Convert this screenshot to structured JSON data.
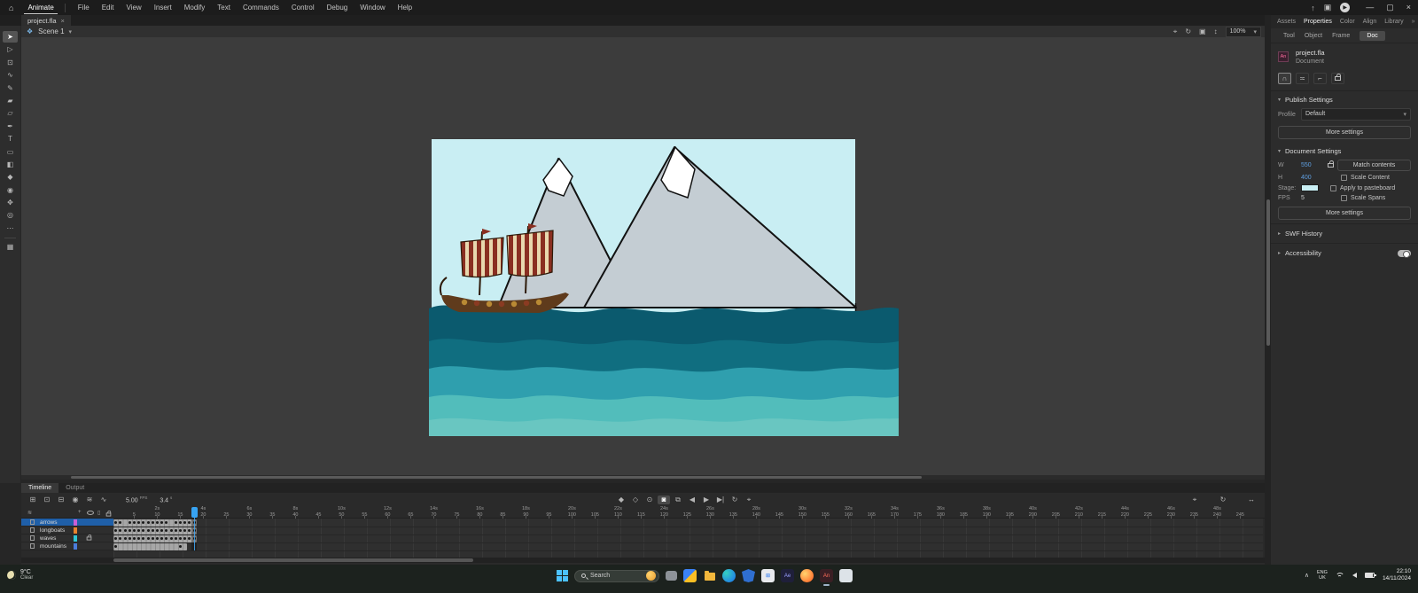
{
  "titlebar": {
    "home_icon": "⌂",
    "app_menu": "Animate",
    "menus": [
      "File",
      "Edit",
      "View",
      "Insert",
      "Modify",
      "Text",
      "Commands",
      "Control",
      "Debug",
      "Window",
      "Help"
    ],
    "share_icon": "↑",
    "workspace_icon": "▣",
    "play_icon": "▶",
    "minimize": "—",
    "maximize": "▢",
    "close": "×"
  },
  "document_tab": {
    "title": "project.fla",
    "close": "×"
  },
  "edit_bar": {
    "scene_icon": "❖",
    "scene": "Scene 1",
    "chevron": "▾",
    "zoom": "100%",
    "icons": [
      {
        "name": "center-stage-icon",
        "glyph": "⌖"
      },
      {
        "name": "rotation-icon",
        "glyph": "↻"
      },
      {
        "name": "clip-content-icon",
        "glyph": "▣"
      },
      {
        "name": "zoom-stepper-icon",
        "glyph": "↕"
      }
    ]
  },
  "tools": {
    "items": [
      {
        "name": "selection-tool",
        "glyph": "➤",
        "selected": true
      },
      {
        "name": "subselection-tool",
        "glyph": "▷",
        "selected": false
      },
      {
        "name": "free-transform-tool",
        "glyph": "⊡",
        "selected": false
      },
      {
        "name": "lasso-tool",
        "glyph": "∿",
        "selected": false
      },
      {
        "name": "fluid-brush-tool",
        "glyph": "✎",
        "selected": false
      },
      {
        "name": "classic-brush-tool",
        "glyph": "▰",
        "selected": false
      },
      {
        "name": "eraser-tool",
        "glyph": "▱",
        "selected": false
      },
      {
        "name": "pen-tool",
        "glyph": "✒",
        "selected": false
      },
      {
        "name": "text-tool",
        "glyph": "T",
        "selected": false
      },
      {
        "name": "rectangle-tool",
        "glyph": "▭",
        "selected": false
      },
      {
        "name": "paint-bucket-tool",
        "glyph": "◧",
        "selected": false
      },
      {
        "name": "eyedropper-tool",
        "glyph": "◆",
        "selected": false
      },
      {
        "name": "camera-tool",
        "glyph": "◉",
        "selected": false
      },
      {
        "name": "hand-tool",
        "glyph": "✥",
        "selected": false
      },
      {
        "name": "zoom-tool",
        "glyph": "◎",
        "selected": false
      }
    ],
    "more": "⋯",
    "footer": "▦"
  },
  "properties_panel": {
    "tabs": [
      {
        "label": "Assets",
        "active": false
      },
      {
        "label": "Properties",
        "active": true
      },
      {
        "label": "Color",
        "active": false
      },
      {
        "label": "Align",
        "active": false
      },
      {
        "label": "Library",
        "active": false
      }
    ],
    "collapse_icon": "»",
    "subtabs": [
      {
        "label": "Tool",
        "active": false
      },
      {
        "label": "Object",
        "active": false
      },
      {
        "label": "Frame",
        "active": false
      },
      {
        "label": "Doc",
        "active": true
      }
    ],
    "doc_logo": "An",
    "doc_name": "project.fla",
    "doc_type": "Document",
    "snap_toggles": [
      {
        "name": "snap-magnet-icon",
        "glyph": "∩",
        "active": true
      },
      {
        "name": "snap-align-icon",
        "glyph": "≍",
        "active": false
      },
      {
        "name": "snap-to-objects-icon",
        "glyph": "⌐",
        "active": false
      },
      {
        "name": "lock-guides-icon",
        "glyph": "lock",
        "active": false
      }
    ],
    "publish": {
      "header": "Publish Settings",
      "profile_label": "Profile",
      "profile_value": "Default",
      "more_button": "More settings"
    },
    "document_settings": {
      "header": "Document Settings",
      "w_label": "W",
      "w_value": "550",
      "h_label": "H",
      "h_value": "400",
      "match_button": "Match contents",
      "scale_content": "Scale Content",
      "stage_label": "Stage:",
      "stage_color": "#c9eff4",
      "apply_pasteboard": "Apply to pasteboard",
      "fps_label": "FPS",
      "fps_value": "5",
      "scale_spans": "Scale Spans",
      "more_button": "More settings"
    },
    "swf_history": "SWF History",
    "accessibility": "Accessibility"
  },
  "stage": {
    "sky_color": "#c9eef3",
    "mountain_color": "#c4cdd3",
    "outline_color": "#121212",
    "snow_color": "#ffffff",
    "sea_colors": [
      "#0b5a6e",
      "#106e80",
      "#2f9fae",
      "#52bdbb",
      "#69c6c1"
    ],
    "boat": {
      "stripe_a": "#8a2f21",
      "stripe_b": "#e8d8ae",
      "hull_color": "#5f3b1c",
      "hull_line": "#2d1a09",
      "shield_a": "#b98a34",
      "shield_b": "#8a3b22"
    }
  },
  "timeline": {
    "tabs": [
      {
        "label": "Timeline",
        "active": true
      },
      {
        "label": "Output",
        "active": false
      }
    ],
    "left_icons": [
      {
        "name": "add-layer-icon",
        "glyph": "⊞"
      },
      {
        "name": "add-folder-icon",
        "glyph": "⊡"
      },
      {
        "name": "delete-layer-icon",
        "glyph": "⊟"
      },
      {
        "name": "camera-icon",
        "glyph": "◉"
      },
      {
        "name": "layer-depth-icon",
        "glyph": "≋"
      },
      {
        "name": "graph-editor-icon",
        "glyph": "∿"
      }
    ],
    "fps_display": "5.00",
    "fps_unit": "FPS",
    "time_display": "3.4",
    "time_unit": "s",
    "playback_icons": [
      {
        "name": "insert-keyframe-icon",
        "glyph": "◆",
        "active": false
      },
      {
        "name": "insert-blank-keyframe-icon",
        "glyph": "◇",
        "active": false
      },
      {
        "name": "auto-keyframe-icon",
        "glyph": "⊙",
        "active": false
      },
      {
        "name": "onion-skin-icon",
        "glyph": "◙",
        "active": true
      },
      {
        "name": "edit-multiple-frames-icon",
        "glyph": "⧉",
        "active": false
      },
      {
        "name": "step-back-icon",
        "glyph": "◀",
        "active": false
      },
      {
        "name": "play-icon",
        "glyph": "▶",
        "active": false
      },
      {
        "name": "step-forward-icon",
        "glyph": "▶|",
        "active": false
      },
      {
        "name": "loop-icon",
        "glyph": "↻",
        "active": false
      },
      {
        "name": "center-playhead-icon",
        "glyph": "⌖",
        "active": false
      }
    ],
    "right_icons": [
      {
        "name": "center-frame-icon",
        "glyph": "⌖"
      },
      {
        "name": "loop-range-icon",
        "glyph": "↻"
      },
      {
        "name": "resize-timeline-icon",
        "glyph": "↔"
      }
    ],
    "playhead_frame": 18,
    "fps": 5,
    "ruler": {
      "label_step": 5,
      "max_frame": 245,
      "seconds_label_step": 2
    },
    "layers": [
      {
        "name": "arrows",
        "color": "#c95fd6",
        "selected": true,
        "locked": false,
        "span": 18,
        "keyframes": [
          1,
          2,
          4,
          5,
          6,
          7,
          8,
          9,
          10,
          11,
          12,
          14,
          15,
          16,
          17,
          18
        ]
      },
      {
        "name": "longboats",
        "color": "#e8822e",
        "selected": false,
        "locked": false,
        "span": 18,
        "keyframes": [
          1,
          2,
          3,
          4,
          5,
          6,
          7,
          8,
          9,
          10,
          11,
          12,
          13,
          14,
          15,
          16,
          17,
          18
        ]
      },
      {
        "name": "waves",
        "color": "#30c7d6",
        "selected": false,
        "locked": true,
        "span": 18,
        "keyframes": [
          1,
          2,
          3,
          4,
          5,
          6,
          7,
          8,
          9,
          10,
          11,
          12,
          13,
          14,
          15,
          16,
          17,
          18
        ]
      },
      {
        "name": "mountains",
        "color": "#4a7ddc",
        "selected": false,
        "locked": false,
        "span": 16,
        "keyframes": [
          1,
          15
        ]
      }
    ]
  },
  "taskbar": {
    "weather_temp": "9°C",
    "weather_condition": "Clear",
    "search_placeholder": "Search",
    "items": [
      {
        "name": "task-view-icon",
        "kind": "taskview"
      },
      {
        "name": "widgets-icon",
        "kind": "widgets"
      },
      {
        "name": "file-explorer-icon",
        "kind": "folder"
      },
      {
        "name": "edge-icon",
        "kind": "edge"
      },
      {
        "name": "defender-icon",
        "kind": "shield"
      },
      {
        "name": "store-icon",
        "kind": "store"
      },
      {
        "name": "after-effects-icon",
        "kind": "ae",
        "label": "Ae"
      },
      {
        "name": "firefox-icon",
        "kind": "firefox"
      },
      {
        "name": "animate-icon",
        "kind": "an",
        "label": "An",
        "active": true
      },
      {
        "name": "notepad-icon",
        "kind": "notepad"
      }
    ],
    "tray_chevron": "∧",
    "lang_line1": "ENG",
    "lang_line2": "UK",
    "time": "22:10",
    "date": "14/11/2024"
  }
}
